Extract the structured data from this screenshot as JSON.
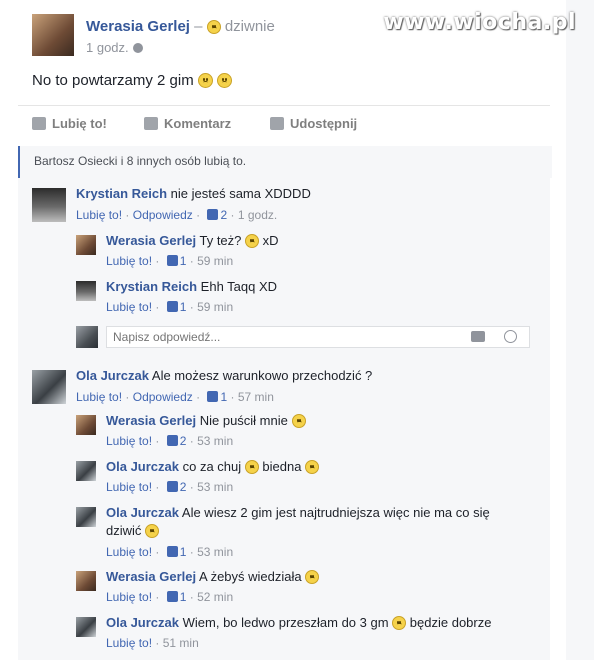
{
  "watermark": "www.wiocha.pl",
  "post": {
    "author": "Werasia Gerlej",
    "dash": "–",
    "feeling": "dziwnie",
    "time": "1 godz.",
    "text": "No to powtarzamy 2 gim"
  },
  "actions": {
    "like": "Lubię to!",
    "comment": "Komentarz",
    "share": "Udostępnij"
  },
  "likes": {
    "names": "Bartosz Osiecki i 8 innych osób",
    "suffix": "lubią to."
  },
  "labels": {
    "like": "Lubię to!",
    "reply": "Odpowiedz",
    "sep": "·"
  },
  "reply_box": {
    "placeholder": "Napisz odpowiedź..."
  },
  "comments": [
    {
      "author": "Krystian Reich",
      "text": "nie jesteś sama XDDDD",
      "likes": "2",
      "time": "1 godz."
    },
    {
      "author": "Werasia Gerlej",
      "text": "Ty też?",
      "text2": "xD",
      "likes": "1",
      "time": "59 min"
    },
    {
      "author": "Krystian Reich",
      "text": "Ehh Taqq XD",
      "likes": "1",
      "time": "59 min"
    },
    {
      "author": "Ola Jurczak",
      "text": "Ale możesz warunkowo przechodzić ?",
      "likes": "1",
      "time": "57 min"
    },
    {
      "author": "Werasia Gerlej",
      "text": "Nie puścił mnie",
      "likes": "2",
      "time": "53 min"
    },
    {
      "author": "Ola Jurczak",
      "text": "co za chuj",
      "text2": "biedna",
      "likes": "2",
      "time": "53 min"
    },
    {
      "author": "Ola Jurczak",
      "text": "Ale wiesz 2 gim jest najtrudniejsza więc nie ma co się",
      "text2": "dziwić",
      "likes": "1",
      "time": "53 min"
    },
    {
      "author": "Werasia Gerlej",
      "text": "A żebyś wiedziała",
      "likes": "1",
      "time": "52 min"
    },
    {
      "author": "Ola Jurczak",
      "text": "Wiem, bo ledwo przeszłam do 3 gm",
      "text2": "będzie dobrze",
      "time": "51 min"
    }
  ],
  "colors": {
    "link": "#365899",
    "action_link": "#4267b2",
    "muted": "#90949c",
    "panel": "#f6f7f9"
  }
}
